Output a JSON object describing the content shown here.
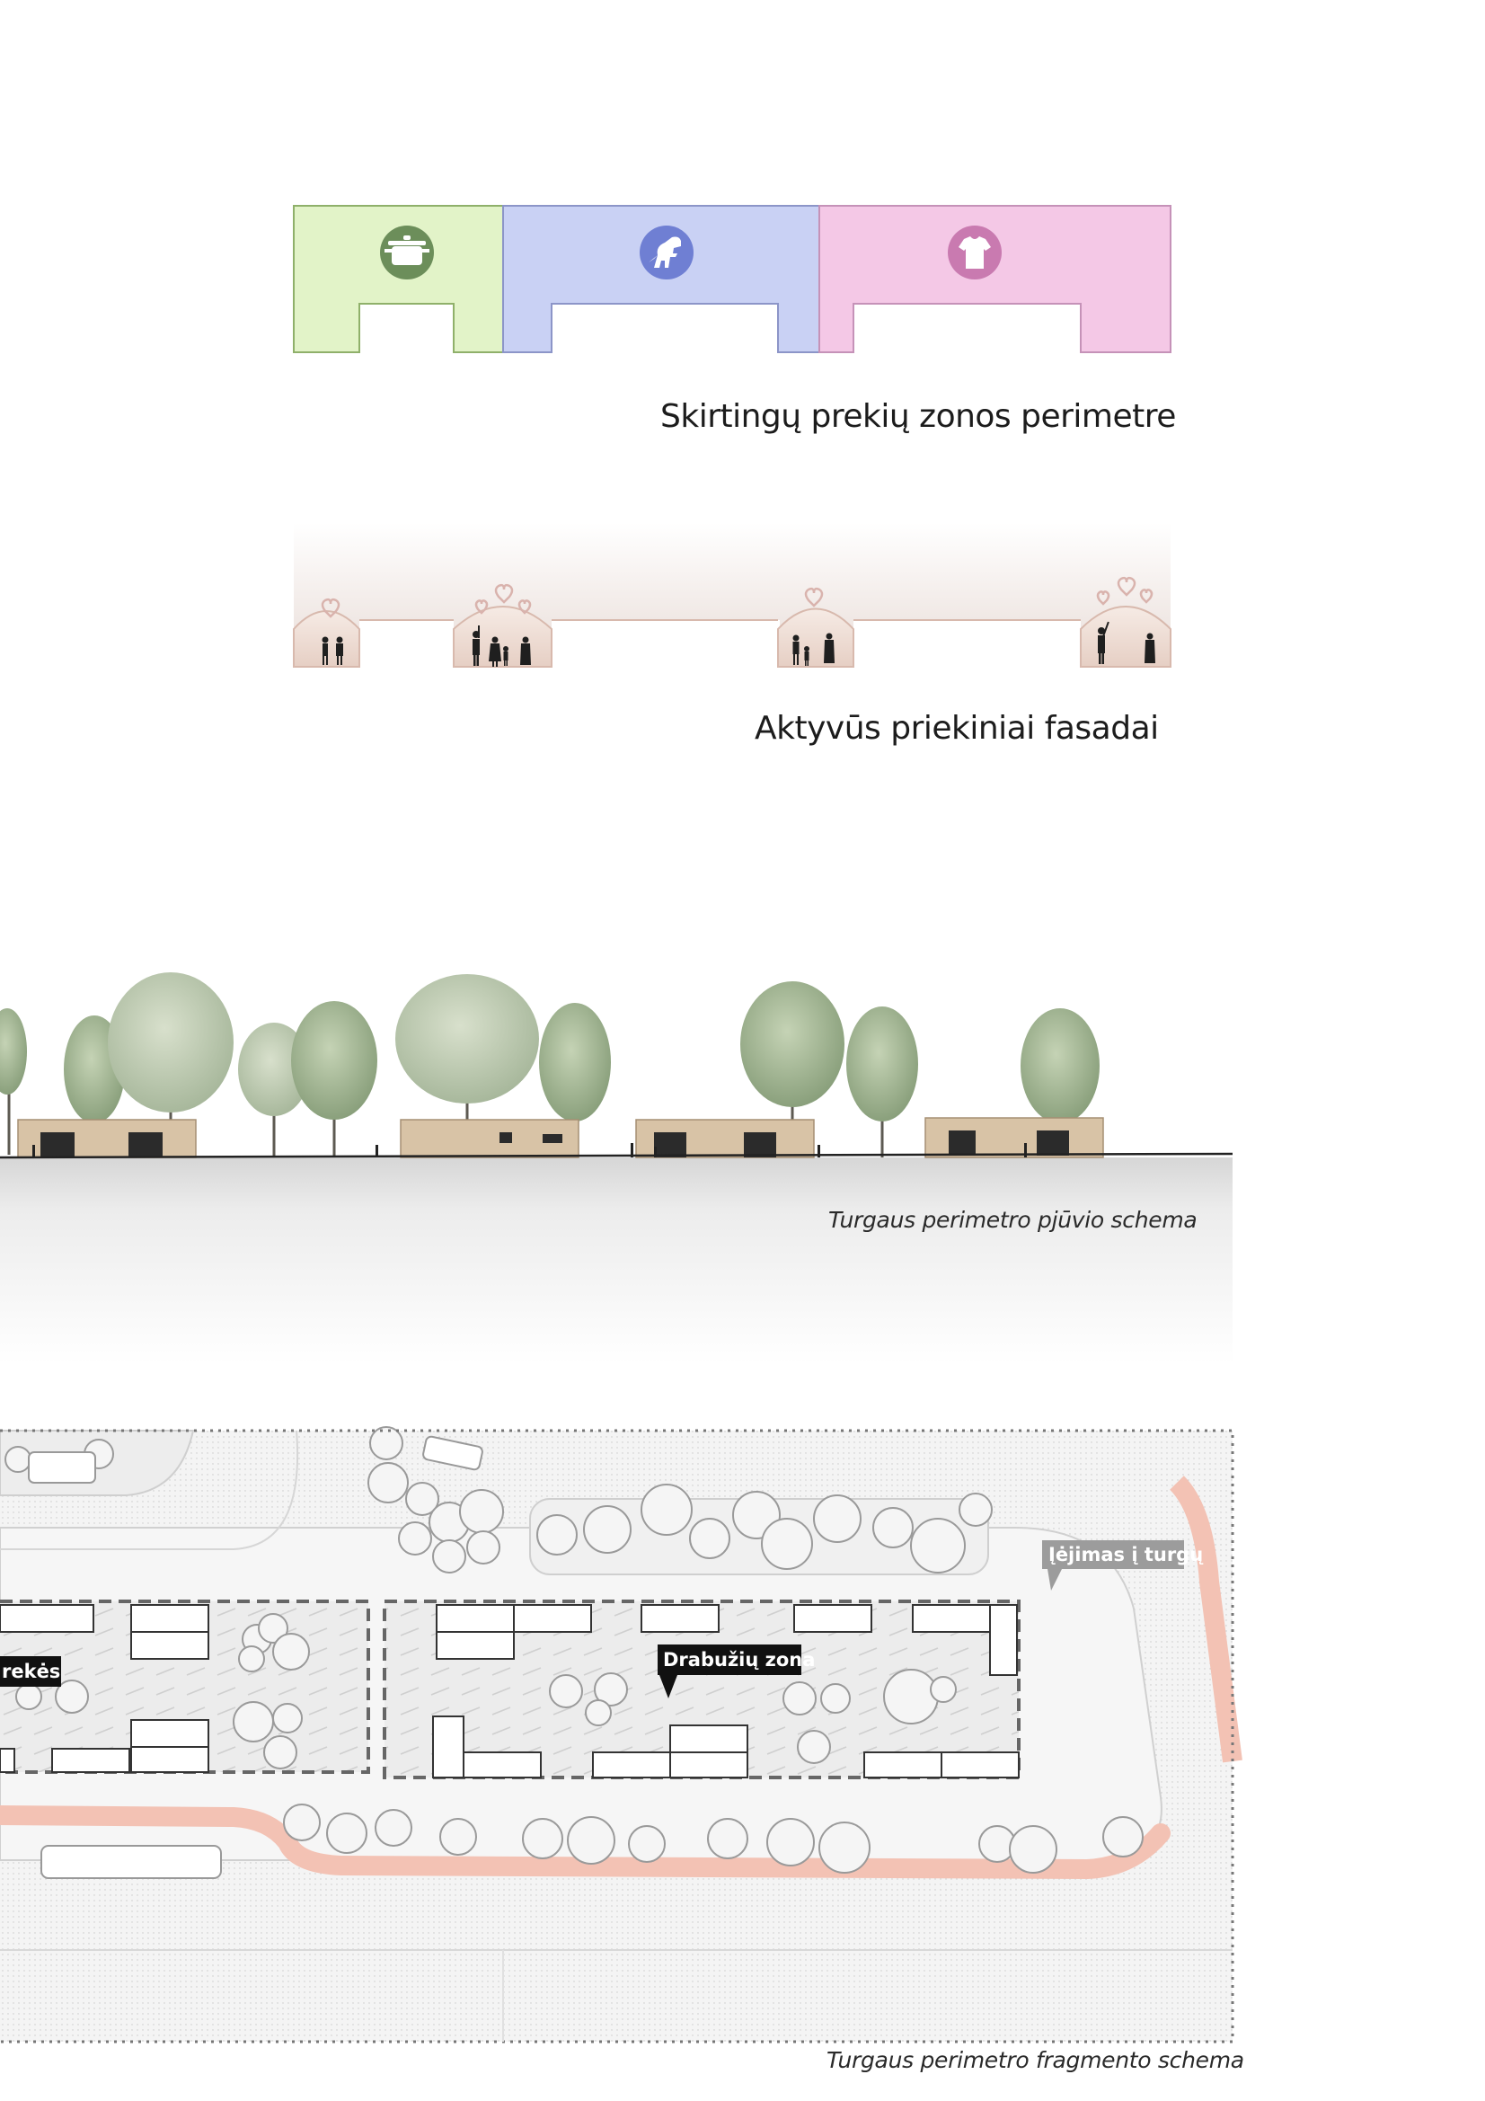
{
  "zones_diagram": {
    "caption": "Skirtingų prekių zonos perimetre",
    "zones": [
      {
        "icon": "cooking-pot-icon",
        "fill": "#e2f3c8",
        "stroke": "#8fb06a",
        "badge": "#6c8e5a"
      },
      {
        "icon": "dinosaur-toy-icon",
        "fill": "#c9d1f4",
        "stroke": "#8c95c8",
        "badge": "#6f7fd3"
      },
      {
        "icon": "t-shirt-icon",
        "fill": "#f4c8e6",
        "stroke": "#c592b8",
        "badge": "#c97ab0"
      }
    ]
  },
  "facades_diagram": {
    "caption": "Aktyvūs priekiniai fasadai",
    "heart_color": "#d9b3ad",
    "bay_fill": "#eddcd3"
  },
  "section_diagram": {
    "caption": "Turgaus perimetro pjūvio schema",
    "building_color": "#d8c3a6"
  },
  "plan_diagram": {
    "caption": "Turgaus perimetro fragmento schema",
    "labels": {
      "entrance": "Įėjimas į turgų",
      "clothing_zone": "Drabužių zona",
      "goods_partial": "rekės"
    },
    "path_color": "#f3c2b4"
  }
}
